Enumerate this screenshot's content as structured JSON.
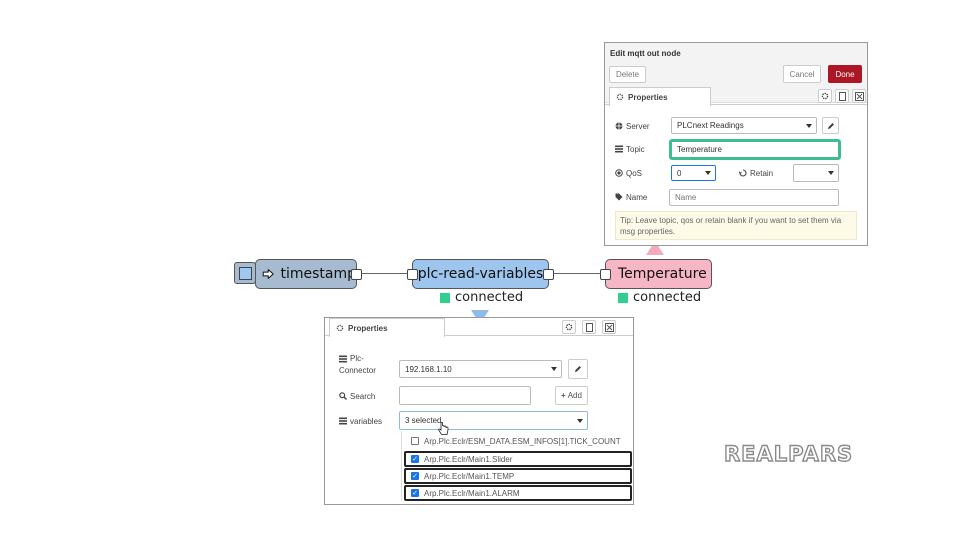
{
  "flow": {
    "nodes": {
      "timestamp": {
        "label": "timestamp",
        "color": "#a6bbcf"
      },
      "plc": {
        "label": "plc-read-variables",
        "color": "#9dc5ee"
      },
      "mqtt": {
        "label": "Temperature",
        "color": "#f6b6c6"
      }
    },
    "status": {
      "plc": "connected",
      "mqtt": "connected",
      "color": "#2fcf8f"
    }
  },
  "mqtt_panel": {
    "title": "Edit mqtt out node",
    "delete_label": "Delete",
    "cancel_label": "Cancel",
    "done_label": "Done",
    "tab_label": "Properties",
    "server_label": "Server",
    "server_value": "PLCnext Readings",
    "topic_label": "Topic",
    "topic_value": "Temperature",
    "qos_label": "QoS",
    "qos_value": "0",
    "retain_label": "Retain",
    "retain_value": "",
    "name_label": "Name",
    "name_placeholder": "Name",
    "tip": "Tip: Leave topic, qos or retain blank if you want to set them via msg properties."
  },
  "plc_panel": {
    "tab_label": "Properties",
    "connector_label_1": "Plc-",
    "connector_label_2": "Connector",
    "connector_value": "192.168.1.10",
    "search_label": "Search",
    "search_value": "",
    "add_label": "Add",
    "variables_label": "variables",
    "variables_value": "3 selected",
    "options": [
      {
        "label": "Arp.Plc.Eclr/ESM_DATA.ESM_INFOS[1].TICK_COUNT",
        "checked": false
      },
      {
        "label": "Arp.Plc.Eclr/Main1.Slider",
        "checked": true
      },
      {
        "label": "Arp.Plc.Eclr/Main1.TEMP",
        "checked": true
      },
      {
        "label": "Arp.Plc.Eclr/Main1.ALARM",
        "checked": true
      }
    ]
  },
  "logo": {
    "text": "REALPARS",
    "color": "#8a8a8a"
  },
  "colors": {
    "done": "#ad1625",
    "topic_highlight": "#3ebd93",
    "accent": "#1a73e8"
  }
}
